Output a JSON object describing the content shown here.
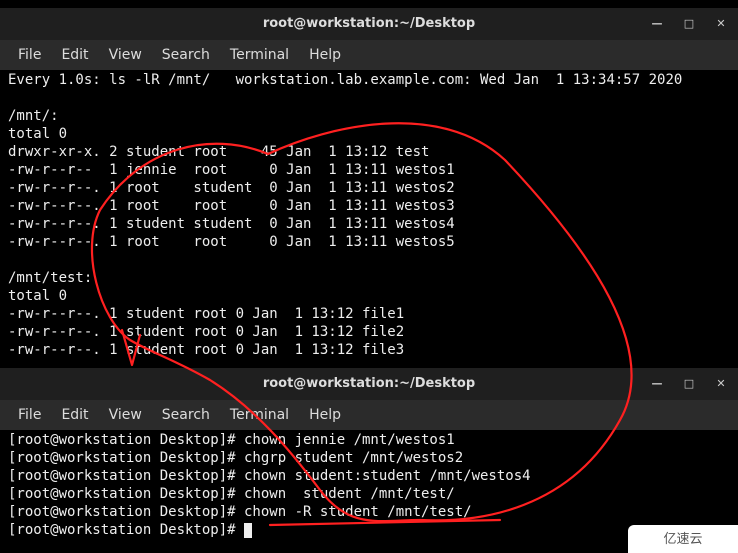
{
  "window1": {
    "title": "root@workstation:~/Desktop",
    "menu": [
      "File",
      "Edit",
      "View",
      "Search",
      "Terminal",
      "Help"
    ],
    "lines": [
      "Every 1.0s: ls -lR /mnt/   workstation.lab.example.com: Wed Jan  1 13:34:57 2020",
      "",
      "/mnt/:",
      "total 0",
      "drwxr-xr-x. 2 student root    45 Jan  1 13:12 test",
      "-rw-r--r--  1 jennie  root     0 Jan  1 13:11 westos1",
      "-rw-r--r--. 1 root    student  0 Jan  1 13:11 westos2",
      "-rw-r--r--. 1 root    root     0 Jan  1 13:11 westos3",
      "-rw-r--r--. 1 student student  0 Jan  1 13:11 westos4",
      "-rw-r--r--. 1 root    root     0 Jan  1 13:11 westos5",
      "",
      "/mnt/test:",
      "total 0",
      "-rw-r--r--. 1 student root 0 Jan  1 13:12 file1",
      "-rw-r--r--. 1 student root 0 Jan  1 13:12 file2",
      "-rw-r--r--. 1 student root 0 Jan  1 13:12 file3"
    ]
  },
  "window2": {
    "title": "root@workstation:~/Desktop",
    "menu": [
      "File",
      "Edit",
      "View",
      "Search",
      "Terminal",
      "Help"
    ],
    "prompt": "[root@workstation Desktop]# ",
    "commands": [
      "chown jennie /mnt/westos1",
      "chgrp student /mnt/westos2",
      "chown student:student /mnt/westos4",
      "chown  student /mnt/test/",
      "chown -R student /mnt/test/"
    ]
  },
  "watermark": "亿速云",
  "icons": {
    "min": "—",
    "max": "□",
    "close": "✕"
  }
}
